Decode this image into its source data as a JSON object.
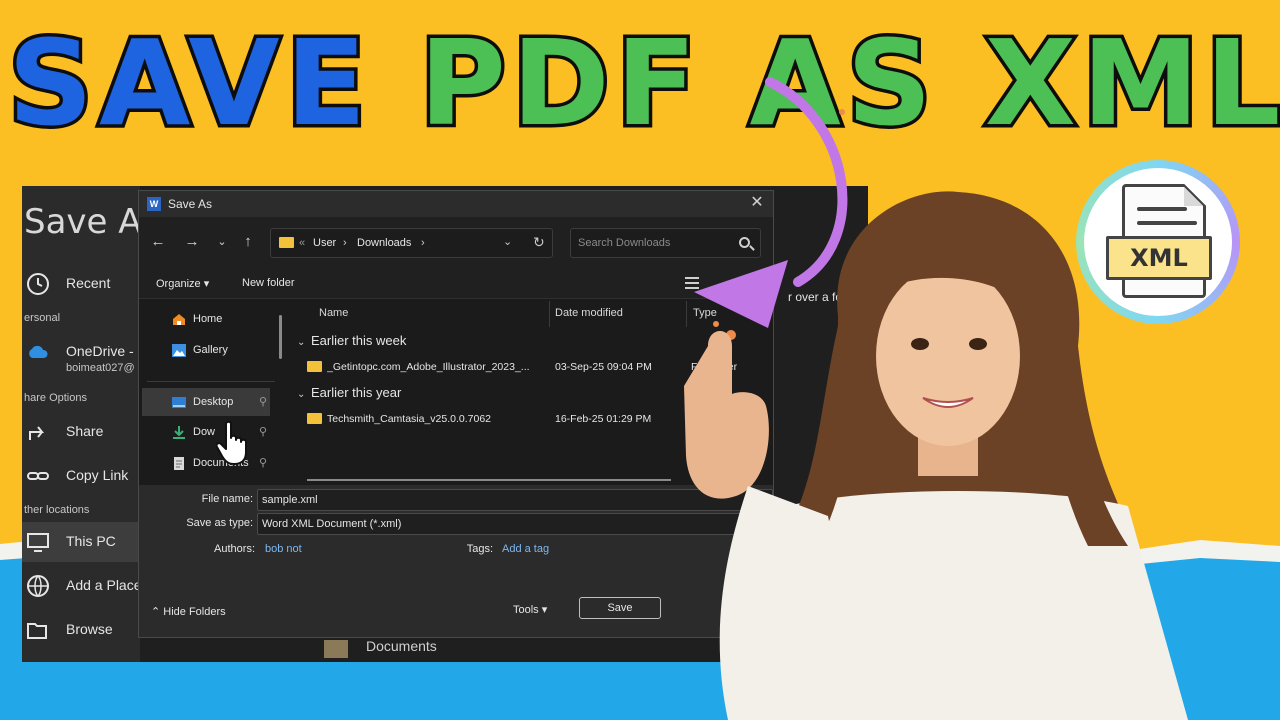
{
  "headline": {
    "word1": "SAVE",
    "word2": "PDF AS XML"
  },
  "back_window": {
    "title": "Save As",
    "recent": "Recent",
    "section_personal": "ersonal",
    "onedrive": "OneDrive -",
    "onedrive_account": "boimeat027@",
    "section_share": "hare Options",
    "share": "Share",
    "copy_link": "Copy Link",
    "section_other": "ther locations",
    "this_pc": "This PC",
    "add_place": "Add a Place",
    "browse": "Browse",
    "hint": "r over a folder.",
    "docs": "Documents"
  },
  "dialog": {
    "title": "Save As",
    "address": {
      "prefix": "«",
      "crumb1": "User",
      "crumb2": "Downloads"
    },
    "search_placeholder": "Search Downloads",
    "toolbar": {
      "organize": "Organize ▾",
      "new_folder": "New folder"
    },
    "nav_items": [
      {
        "label": "Home"
      },
      {
        "label": "Gallery"
      },
      {
        "label": "Desktop"
      },
      {
        "label": "Dow"
      },
      {
        "label": "Documents"
      }
    ],
    "columns": {
      "name": "Name",
      "date": "Date modified",
      "type": "Type"
    },
    "groups": [
      {
        "label": "Earlier this week",
        "files": [
          {
            "name": "_Getintopc.com_Adobe_Illustrator_2023_...",
            "date": "03-Sep-25 09:04 PM",
            "type": "File folder"
          }
        ]
      },
      {
        "label": "Earlier this year",
        "files": [
          {
            "name": "Techsmith_Camtasia_v25.0.0.7062",
            "date": "16-Feb-25 01:29 PM",
            "type": "File folder"
          }
        ]
      }
    ],
    "file_name_label": "File name:",
    "file_name_value": "sample.xml",
    "save_type_label": "Save as type:",
    "save_type_value": "Word XML Document (*.xml)",
    "authors_label": "Authors:",
    "authors_value": "bob not",
    "tags_label": "Tags:",
    "tags_value": "Add a tag",
    "hide_folders": "Hide Folders",
    "tools": "Tools",
    "save": "Save"
  },
  "badge": {
    "label": "XML"
  },
  "colors": {
    "title_blue": "#1e63e0",
    "title_green": "#4cbf55",
    "bg_yellow": "#fbbf24",
    "bg_blue": "#22a7e8",
    "arrow_purple": "#c178e6"
  }
}
